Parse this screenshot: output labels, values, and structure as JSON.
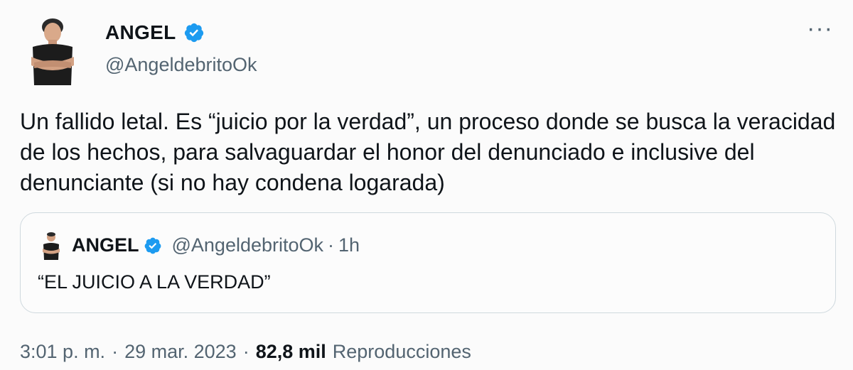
{
  "author": {
    "display_name": "ANGEL",
    "handle": "@AngeldebritoOk"
  },
  "more_menu": "···",
  "tweet": {
    "text": "Un fallido letal. Es “juicio por la verdad”, un proceso donde se busca la veracidad de los hechos, para salvaguardar el honor del denunciado e inclusive del denunciante (si no hay condena logarada)"
  },
  "quoted_tweet": {
    "display_name": "ANGEL",
    "handle": "@AngeldebritoOk",
    "separator": "·",
    "time": "1h",
    "text": "“EL JUICIO A LA VERDAD”"
  },
  "meta": {
    "time": "3:01 p. m.",
    "separator": "·",
    "date": "29 mar. 2023",
    "views_count": "82,8 mil",
    "views_label": "Reproducciones"
  },
  "colors": {
    "verified_badge": "#1d9bf0",
    "secondary_text": "#536471",
    "border": "#cfd9de"
  },
  "icons": {
    "verified": "verified-badge-icon",
    "more": "more-options-icon"
  }
}
